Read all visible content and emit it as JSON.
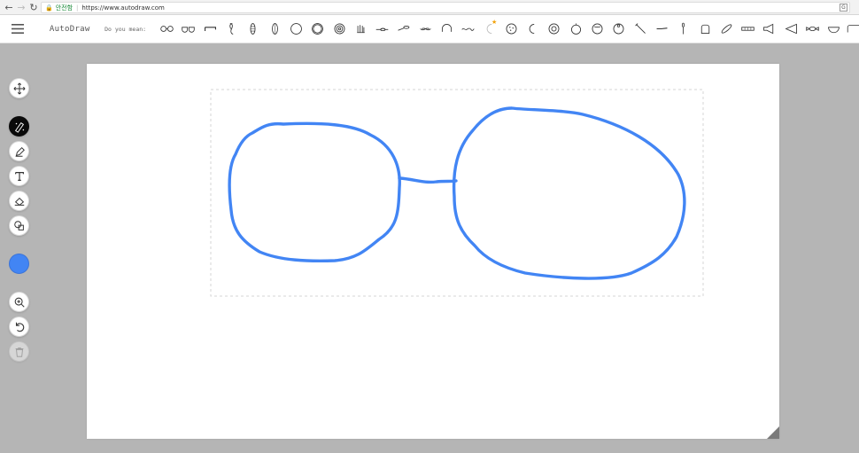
{
  "browser": {
    "secure_label": "안전함",
    "url": "https://www.autodraw.com"
  },
  "app": {
    "title": "AutoDraw",
    "suggestion_label": "Do you mean:",
    "suggestions": [
      "glasses-1",
      "glasses-2",
      "eyebrow",
      "bead",
      "bead-2",
      "capsule",
      "circle",
      "ring",
      "target",
      "fries",
      "sponge",
      "spoon",
      "fish",
      "mustache",
      "helmet",
      "worm",
      "moon-star",
      "cookie",
      "crescent",
      "donut",
      "apple",
      "pumpkin",
      "round-fruit",
      "ball",
      "sword",
      "knife",
      "spoon-2",
      "bread",
      "baguette",
      "harmonica",
      "megaphone",
      "triangle-flag",
      "candy",
      "bowl",
      "partial"
    ]
  },
  "tools": [
    {
      "name": "move-tool",
      "icon": "move-icon"
    },
    {
      "name": "autodraw-tool",
      "icon": "autodraw-icon",
      "active": true
    },
    {
      "name": "draw-tool",
      "icon": "pencil-icon"
    },
    {
      "name": "type-tool",
      "icon": "text-icon"
    },
    {
      "name": "fill-tool",
      "icon": "bucket-icon"
    },
    {
      "name": "shape-tool",
      "icon": "shapes-icon"
    },
    {
      "name": "zoom-tool",
      "icon": "zoom-icon"
    },
    {
      "name": "undo-tool",
      "icon": "undo-icon"
    },
    {
      "name": "delete-tool",
      "icon": "trash-icon",
      "disabled": true
    }
  ],
  "colors": {
    "stroke": "#4285f4",
    "active_tool": "#0a0a0a",
    "secure": "#1b8a3a",
    "star": "#f2a20a"
  }
}
